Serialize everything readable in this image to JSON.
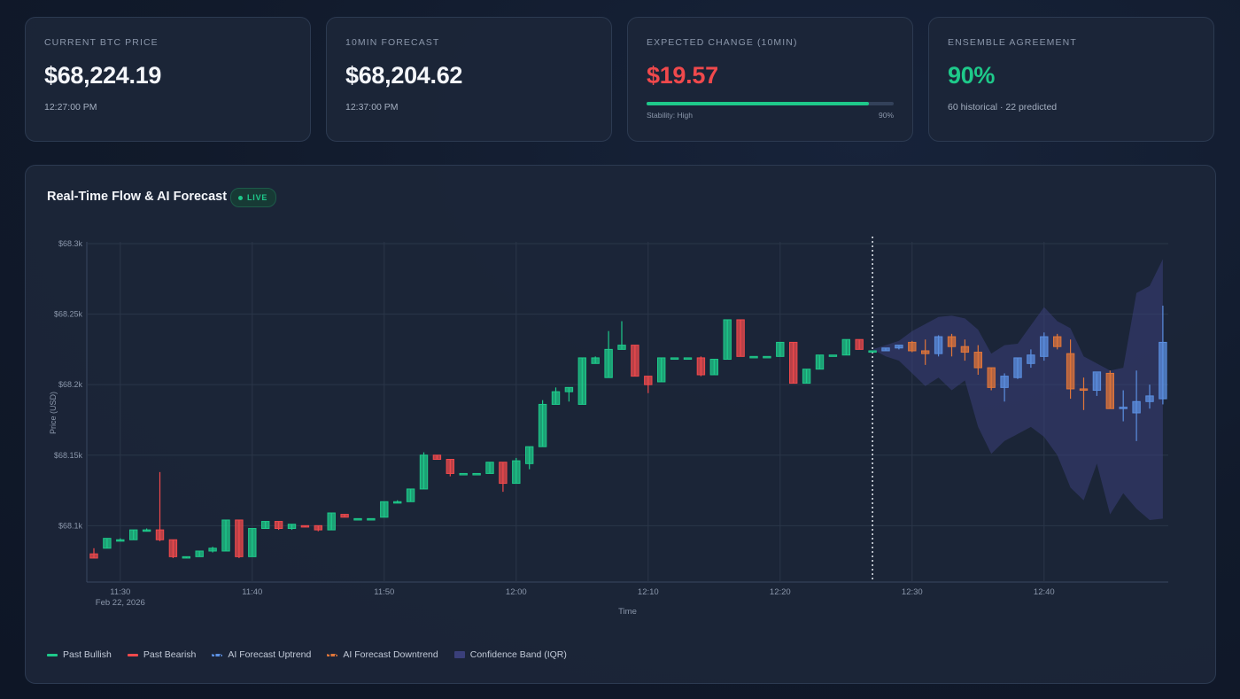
{
  "cards": [
    {
      "label": "CURRENT BTC PRICE",
      "value": "$68,224.19",
      "sub": "12:27:00 PM"
    },
    {
      "label": "10MIN FORECAST",
      "value": "$68,204.62",
      "sub": "12:37:00 PM"
    },
    {
      "label": "EXPECTED CHANGE (10MIN)",
      "value": "$19.57",
      "value_color": "#f0494c",
      "progress": 0.9,
      "progress_label": "Stability: High",
      "progress_value": "90%"
    },
    {
      "label": "ENSEMBLE AGREEMENT",
      "value": "90%",
      "value_color": "#1ec98a",
      "sub": "60 historical · 22 predicted"
    }
  ],
  "panel": {
    "title": "Real-Time Flow & AI Forecast",
    "badge": "LIVE"
  },
  "legend": [
    {
      "label": "Past Bullish",
      "color": "#1ec98a"
    },
    {
      "label": "Past Bearish",
      "color": "#f0494c"
    },
    {
      "label": "AI Forecast Uptrend",
      "color": "#5b8fe0"
    },
    {
      "label": "AI Forecast Downtrend",
      "color": "#e0763a"
    },
    {
      "label": "Confidence Band (IQR)",
      "color": "#3a3f7a"
    }
  ],
  "chart_data": {
    "type": "candlestick",
    "xlabel": "Time",
    "ylabel": "Price (USD)",
    "ylim": [
      68060,
      68300
    ],
    "yticks": [
      68100,
      68150,
      68200,
      68250,
      68300
    ],
    "ytick_labels": [
      "$68.1k",
      "$68.15k",
      "$68.2k",
      "$68.25k",
      "$68.3k"
    ],
    "xticks": [
      "11:30",
      "11:40",
      "11:50",
      "12:00",
      "12:10",
      "12:20",
      "12:30",
      "12:40"
    ],
    "xtick_sublabel": "Feb 22, 2026",
    "x_start": "11:28",
    "now": "12:27",
    "historical": [
      [
        "11:28",
        68080,
        68084,
        68077,
        68077
      ],
      [
        "11:29",
        68084,
        68091,
        68084,
        68091
      ],
      [
        "11:30",
        68090,
        68091,
        68089,
        68090
      ],
      [
        "11:31",
        68090,
        68097,
        68090,
        68097
      ],
      [
        "11:32",
        68097,
        68098,
        68096,
        68097
      ],
      [
        "11:33",
        68097,
        68138,
        68089,
        68090
      ],
      [
        "11:34",
        68090,
        68090,
        68077,
        68078
      ],
      [
        "11:35",
        68078,
        68078,
        68077,
        68078
      ],
      [
        "11:36",
        68078,
        68082,
        68078,
        68082
      ],
      [
        "11:37",
        68082,
        68085,
        68081,
        68084
      ],
      [
        "11:38",
        68082,
        68104,
        68082,
        68104
      ],
      [
        "11:39",
        68104,
        68104,
        68077,
        68078
      ],
      [
        "11:40",
        68078,
        68098,
        68078,
        68098
      ],
      [
        "11:41",
        68098,
        68103,
        68098,
        68103
      ],
      [
        "11:42",
        68103,
        68103,
        68097,
        68098
      ],
      [
        "11:43",
        68098,
        68101,
        68097,
        68101
      ],
      [
        "11:44",
        68100,
        68100,
        68099,
        68099
      ],
      [
        "11:45",
        68100,
        68100,
        68096,
        68097
      ],
      [
        "11:46",
        68097,
        68109,
        68097,
        68109
      ],
      [
        "11:47",
        68108,
        68108,
        68106,
        68106
      ],
      [
        "11:48",
        68105,
        68105,
        68105,
        68105
      ],
      [
        "11:49",
        68105,
        68105,
        68105,
        68105
      ],
      [
        "11:50",
        68106,
        68117,
        68106,
        68117
      ],
      [
        "11:51",
        68117,
        68118,
        68116,
        68117
      ],
      [
        "11:52",
        68117,
        68126,
        68117,
        68126
      ],
      [
        "11:53",
        68126,
        68152,
        68126,
        68150
      ],
      [
        "11:54",
        68150,
        68150,
        68147,
        68147
      ],
      [
        "11:55",
        68147,
        68147,
        68135,
        68137
      ],
      [
        "11:56",
        68137,
        68137,
        68137,
        68137
      ],
      [
        "11:57",
        68137,
        68137,
        68137,
        68137
      ],
      [
        "11:58",
        68137,
        68145,
        68137,
        68145
      ],
      [
        "11:59",
        68145,
        68145,
        68124,
        68130
      ],
      [
        "12:00",
        68130,
        68148,
        68130,
        68146
      ],
      [
        "12:01",
        68144,
        68156,
        68140,
        68156
      ],
      [
        "12:02",
        68156,
        68189,
        68156,
        68186
      ],
      [
        "12:03",
        68186,
        68198,
        68186,
        68195
      ],
      [
        "12:04",
        68195,
        68198,
        68188,
        68198
      ],
      [
        "12:05",
        68186,
        68219,
        68186,
        68219
      ],
      [
        "12:06",
        68215,
        68220,
        68215,
        68219
      ],
      [
        "12:07",
        68205,
        68238,
        68205,
        68225
      ],
      [
        "12:08",
        68225,
        68245,
        68225,
        68228
      ],
      [
        "12:09",
        68228,
        68228,
        68206,
        68206
      ],
      [
        "12:10",
        68206,
        68206,
        68194,
        68200
      ],
      [
        "12:11",
        68202,
        68219,
        68202,
        68219
      ],
      [
        "12:12",
        68219,
        68219,
        68219,
        68219
      ],
      [
        "12:13",
        68219,
        68219,
        68219,
        68219
      ],
      [
        "12:14",
        68219,
        68220,
        68206,
        68207
      ],
      [
        "12:15",
        68207,
        68218,
        68207,
        68218
      ],
      [
        "12:16",
        68218,
        68246,
        68218,
        68246
      ],
      [
        "12:17",
        68246,
        68246,
        68220,
        68220
      ],
      [
        "12:18",
        68220,
        68220,
        68220,
        68220
      ],
      [
        "12:19",
        68220,
        68220,
        68220,
        68220
      ],
      [
        "12:20",
        68220,
        68230,
        68220,
        68230
      ],
      [
        "12:21",
        68230,
        68230,
        68201,
        68201
      ],
      [
        "12:22",
        68201,
        68211,
        68201,
        68211
      ],
      [
        "12:23",
        68211,
        68221,
        68211,
        68221
      ],
      [
        "12:24",
        68221,
        68221,
        68221,
        68221
      ],
      [
        "12:25",
        68221,
        68232,
        68221,
        68232
      ],
      [
        "12:26",
        68232,
        68232,
        68225,
        68225
      ],
      [
        "12:27",
        68224,
        68224,
        68224,
        68224
      ]
    ],
    "forecast": [
      [
        "12:28",
        68224,
        68226,
        68224,
        68226
      ],
      [
        "12:29",
        68226,
        68228,
        68225,
        68228
      ],
      [
        "12:30",
        68230,
        68231,
        68223,
        68224
      ],
      [
        "12:31",
        68224,
        68232,
        68214,
        68222
      ],
      [
        "12:32",
        68222,
        68235,
        68220,
        68234
      ],
      [
        "12:33",
        68234,
        68236,
        68220,
        68227
      ],
      [
        "12:34",
        68227,
        68232,
        68217,
        68223
      ],
      [
        "12:35",
        68223,
        68228,
        68207,
        68212
      ],
      [
        "12:36",
        68212,
        68212,
        68196,
        68198
      ],
      [
        "12:37",
        68198,
        68208,
        68188,
        68206
      ],
      [
        "12:38",
        68205,
        68219,
        68204,
        68219
      ],
      [
        "12:39",
        68215,
        68225,
        68212,
        68221
      ],
      [
        "12:40",
        68220,
        68237,
        68217,
        68234
      ],
      [
        "12:41",
        68234,
        68236,
        68225,
        68227
      ],
      [
        "12:42",
        68222,
        68232,
        68190,
        68197
      ],
      [
        "12:43",
        68197,
        68205,
        68182,
        68196
      ],
      [
        "12:44",
        68196,
        68208,
        68192,
        68209
      ],
      [
        "12:45",
        68208,
        68210,
        68183,
        68183
      ],
      [
        "12:46",
        68183,
        68196,
        68174,
        68184
      ],
      [
        "12:47",
        68180,
        68210,
        68160,
        68188
      ],
      [
        "12:48",
        68188,
        68200,
        68183,
        68192
      ],
      [
        "12:49",
        68190,
        68256,
        68186,
        68230
      ]
    ],
    "confidence_band": [
      [
        "12:27",
        68225,
        68225
      ],
      [
        "12:28",
        68228,
        68220
      ],
      [
        "12:29",
        68231,
        68217
      ],
      [
        "12:30",
        68238,
        68208
      ],
      [
        "12:31",
        68243,
        68199
      ],
      [
        "12:32",
        68248,
        68205
      ],
      [
        "12:33",
        68249,
        68196
      ],
      [
        "12:34",
        68247,
        68203
      ],
      [
        "12:35",
        68239,
        68170
      ],
      [
        "12:36",
        68222,
        68151
      ],
      [
        "12:37",
        68228,
        68160
      ],
      [
        "12:38",
        68229,
        68165
      ],
      [
        "12:39",
        68242,
        68170
      ],
      [
        "12:40",
        68255,
        68163
      ],
      [
        "12:41",
        68245,
        68150
      ],
      [
        "12:42",
        68240,
        68127
      ],
      [
        "12:43",
        68220,
        68118
      ],
      [
        "12:44",
        68215,
        68144
      ],
      [
        "12:45",
        68210,
        68108
      ],
      [
        "12:46",
        68212,
        68123
      ],
      [
        "12:47",
        68265,
        68112
      ],
      [
        "12:48",
        68270,
        68104
      ],
      [
        "12:49",
        68289,
        68105
      ]
    ]
  }
}
